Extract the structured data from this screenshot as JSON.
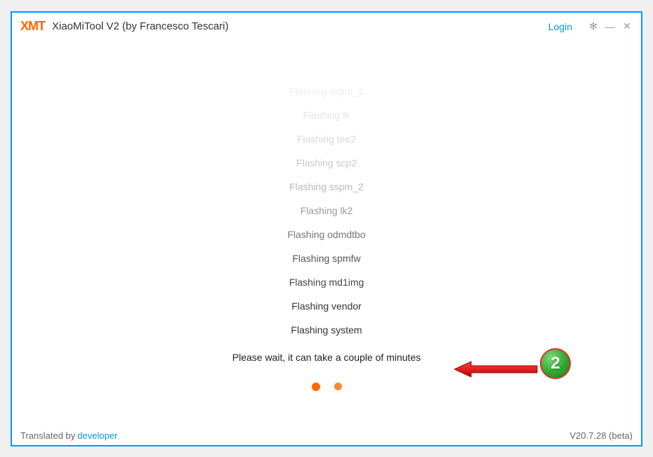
{
  "header": {
    "logo": "XMT",
    "title": "XiaoMiTool V2 (by Francesco Tescari)",
    "login": "Login"
  },
  "log": [
    "Flashing sspm_1",
    "Flashing lk",
    "Flashing tee2",
    "Flashing scp2",
    "Flashing sspm_2",
    "Flashing lk2",
    "Flashing odmdtbo",
    "Flashing spmfw",
    "Flashing md1img",
    "Flashing vendor",
    "Flashing system"
  ],
  "status": "Please wait, it can take a couple of minutes",
  "footer": {
    "translated_prefix": "Translated by",
    "translated_by": "developer",
    "version": "V20.7.28 (beta)"
  },
  "annotation": {
    "number": "2"
  }
}
